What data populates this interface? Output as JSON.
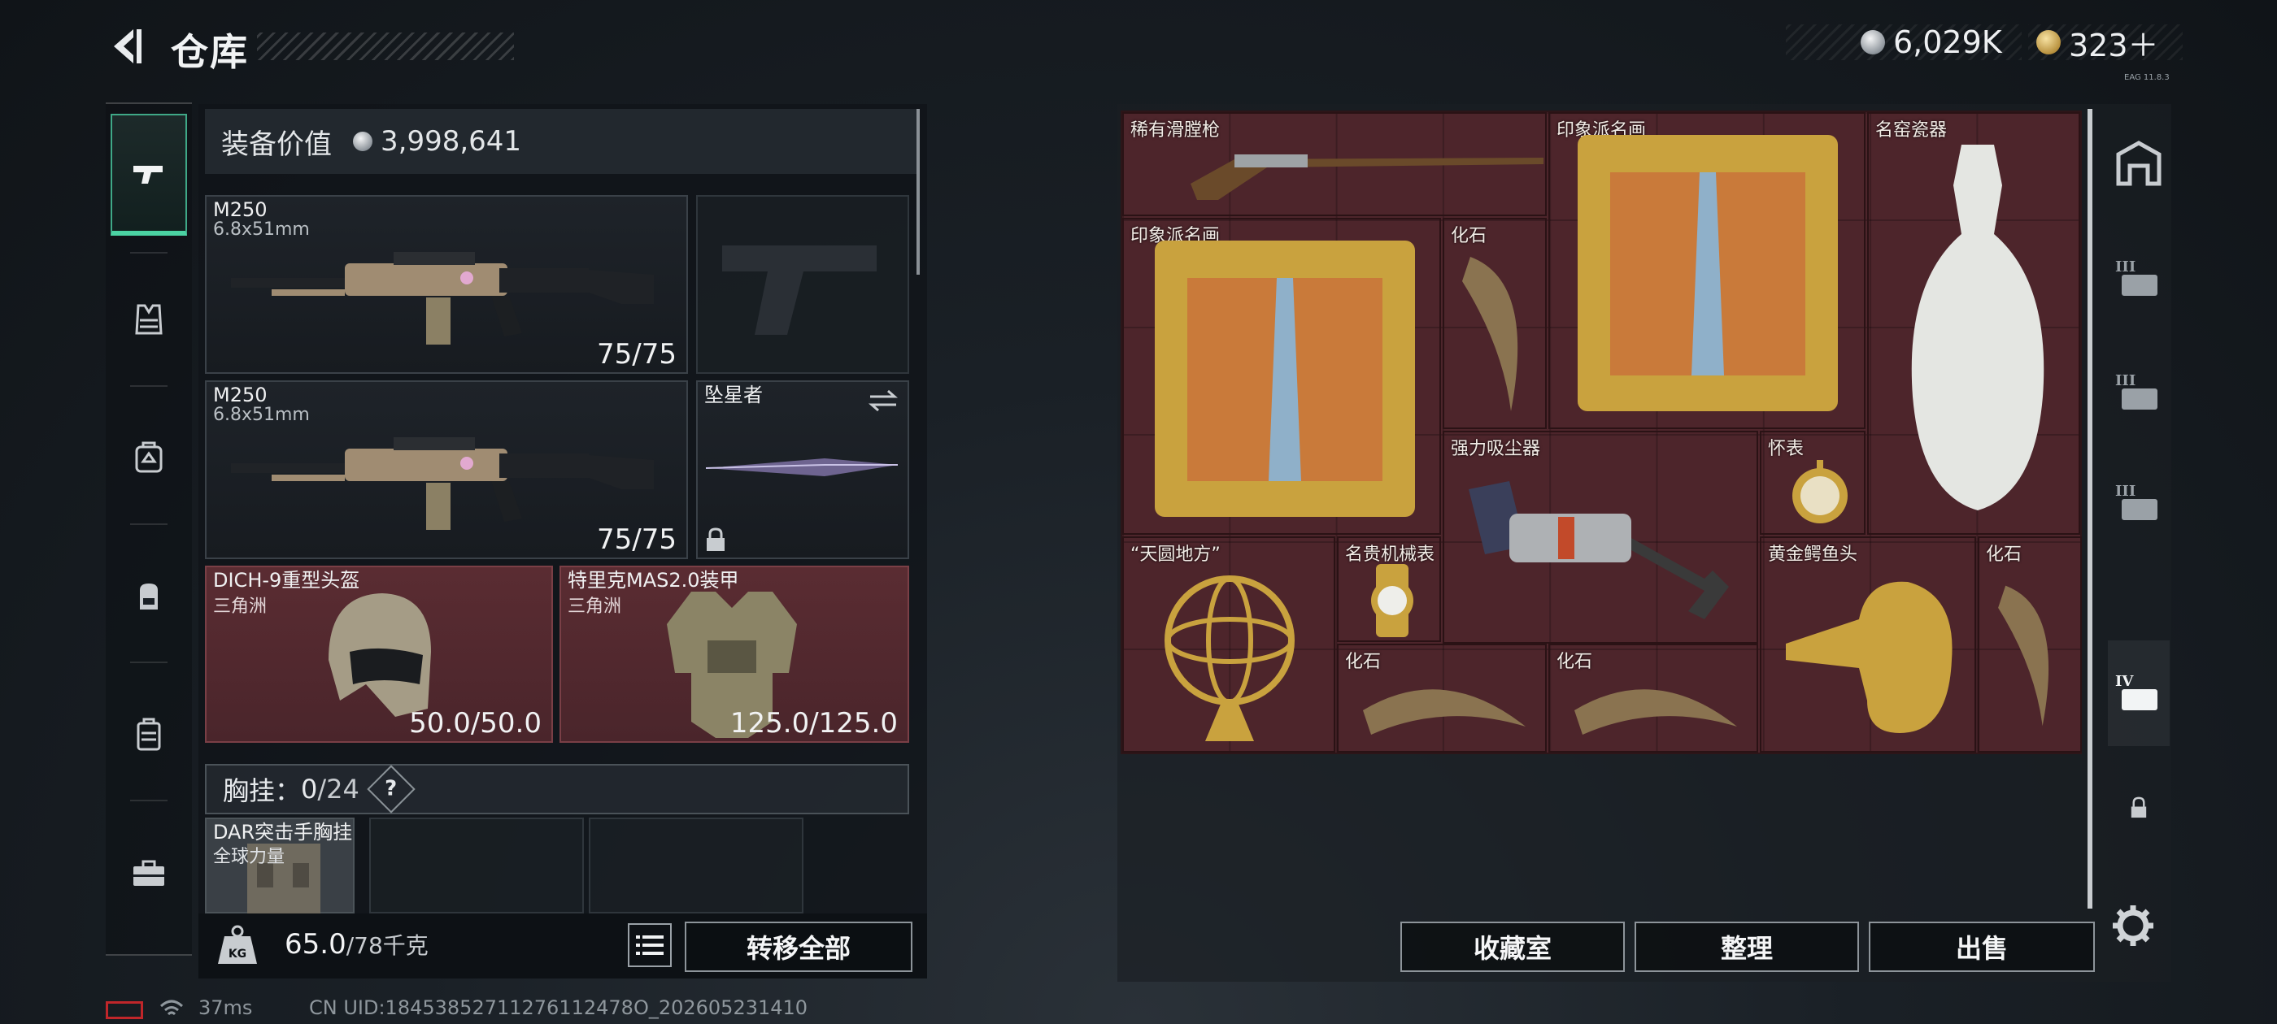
{
  "header": {
    "title": "仓库",
    "currency_silver": "6,029K",
    "currency_gold": "323＋",
    "corner_text": "EAG 11.8.3"
  },
  "left_nav": {
    "items": [
      {
        "name": "weapons",
        "active": true
      },
      {
        "name": "vest",
        "active": false
      },
      {
        "name": "backpack-armor",
        "active": false
      },
      {
        "name": "backpack",
        "active": false
      },
      {
        "name": "case",
        "active": false
      },
      {
        "name": "toolbox",
        "active": false
      }
    ]
  },
  "equipment": {
    "label": "装备价值",
    "value": "3,998,641",
    "slots": [
      {
        "name": "M250",
        "sub": "6.8x51mm",
        "value": "75/75"
      },
      {
        "name": "",
        "sub": "",
        "value": ""
      },
      {
        "name": "M250",
        "sub": "6.8x51mm",
        "value": "75/75"
      },
      {
        "name": "坠星者",
        "sub": "",
        "value": ""
      },
      {
        "name": "DICH-9重型头盔",
        "sub": "三角洲",
        "value": "50.0/50.0"
      },
      {
        "name": "特里克MAS2.0装甲",
        "sub": "三角洲",
        "value": "125.0/125.0"
      }
    ],
    "chest_label": "胸挂：",
    "chest_count": "0",
    "chest_cap": "/24",
    "chest_help": "?",
    "rig_name": "DAR突击手胸挂",
    "rig_sub": "全球力量"
  },
  "bottom": {
    "weight": "65.0",
    "weight_unit": "/78千克",
    "transfer_all": "转移全部"
  },
  "stash_items": [
    {
      "name": "稀有滑膛枪",
      "icon": "flintlock-musket"
    },
    {
      "name": "印象派名画",
      "icon": "framed-painting"
    },
    {
      "name": "名窑瓷器",
      "icon": "porcelain-vase"
    },
    {
      "name": "印象派名画",
      "icon": "framed-painting"
    },
    {
      "name": "化石",
      "icon": "fossil-claw"
    },
    {
      "name": "强力吸尘器",
      "icon": "vacuum-cleaner"
    },
    {
      "name": "怀表",
      "icon": "pocket-watch"
    },
    {
      "name": "“天圆地方”",
      "icon": "armillary-sphere"
    },
    {
      "name": "名贵机械表",
      "icon": "wristwatch"
    },
    {
      "name": "黄金鳄鱼头",
      "icon": "gold-crocodile-head"
    },
    {
      "name": "化石",
      "icon": "fossil-claw"
    },
    {
      "name": "化石",
      "icon": "fossil-claw"
    },
    {
      "name": "化石",
      "icon": "fossil-claw"
    }
  ],
  "actions": {
    "collection": "收藏室",
    "organize": "整理",
    "sell": "出售"
  },
  "right_nav": {
    "items": [
      "stash-icon",
      "container-III-icon",
      "container-III-icon",
      "container-III-icon",
      "container-IV-icon",
      "lock-icon"
    ],
    "settings": "settings-icon"
  },
  "status_bar": {
    "ping": "37ms",
    "uid": "CN UID:18453852711276112478O_202605231410"
  },
  "colors": {
    "accent": "#4bd3a3",
    "slot_red": "#4d252b"
  }
}
